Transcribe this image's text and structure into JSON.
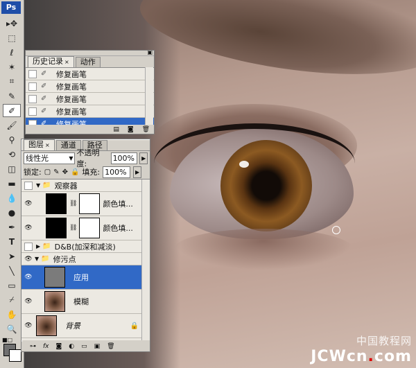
{
  "app": {
    "logo": "Ps"
  },
  "history_panel": {
    "tabs": [
      {
        "label": "历史记录",
        "close": "×"
      },
      {
        "label": "动作"
      }
    ],
    "items": [
      {
        "label": "修复画笔"
      },
      {
        "label": "修复画笔"
      },
      {
        "label": "修复画笔"
      },
      {
        "label": "修复画笔"
      },
      {
        "label": "修复画笔",
        "selected": true
      }
    ]
  },
  "layers_panel": {
    "tabs": [
      {
        "label": "图层",
        "close": "×"
      },
      {
        "label": "通道"
      },
      {
        "label": "路径"
      }
    ],
    "blend_mode": "线性光",
    "opacity_label": "不透明度:",
    "opacity_value": "100%",
    "lock_label": "锁定:",
    "fill_label": "填充:",
    "fill_value": "100%",
    "layers": [
      {
        "type": "group",
        "name": "观察器",
        "visible": false
      },
      {
        "type": "fill",
        "name": "颜色填..."
      },
      {
        "type": "fill",
        "name": "颜色填..."
      },
      {
        "type": "group",
        "name": "D&B(加深和减淡)",
        "visible": false
      },
      {
        "type": "group",
        "name": "修污点",
        "visible": true
      },
      {
        "type": "layer",
        "name": "应用",
        "selected": true
      },
      {
        "type": "layer",
        "name": "模糊"
      },
      {
        "type": "background",
        "name": "背景"
      }
    ],
    "footer_icons": [
      "link-icon",
      "fx-icon",
      "mask-icon",
      "adjustment-icon",
      "folder-icon",
      "new-layer-icon",
      "trash-icon"
    ]
  },
  "watermark": {
    "line1": "中国教程网",
    "line2_a": "JCWcn",
    "line2_dot": ".",
    "line2_b": "com"
  }
}
